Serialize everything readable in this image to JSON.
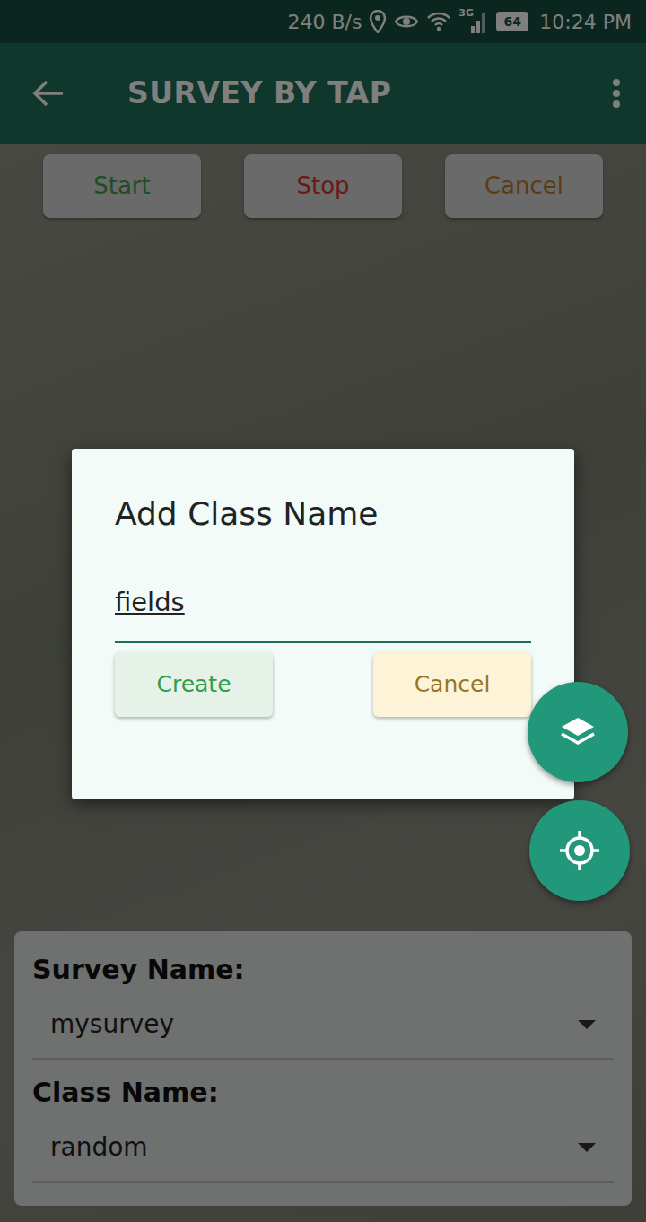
{
  "status_bar": {
    "speed": "240 B/s",
    "network": "3G",
    "battery": "64",
    "time": "10:24 PM"
  },
  "app_bar": {
    "title": "SURVEY BY TAP"
  },
  "controls": [
    {
      "label": "Start",
      "color": "#3f9b4c"
    },
    {
      "label": "Stop",
      "color": "#d6372c"
    },
    {
      "label": "Cancel",
      "color": "#b8782a"
    }
  ],
  "panel": {
    "fields": [
      {
        "label": "Survey Name:",
        "value": "mysurvey"
      },
      {
        "label": "Class Name:",
        "value": "random"
      }
    ]
  },
  "dialog": {
    "open": true,
    "title": "Add Class Name",
    "value": "fields",
    "buttons": [
      {
        "label": "Create",
        "color": "#2e9e4a"
      },
      {
        "label": "Cancel",
        "color": "#9a7426"
      }
    ]
  }
}
